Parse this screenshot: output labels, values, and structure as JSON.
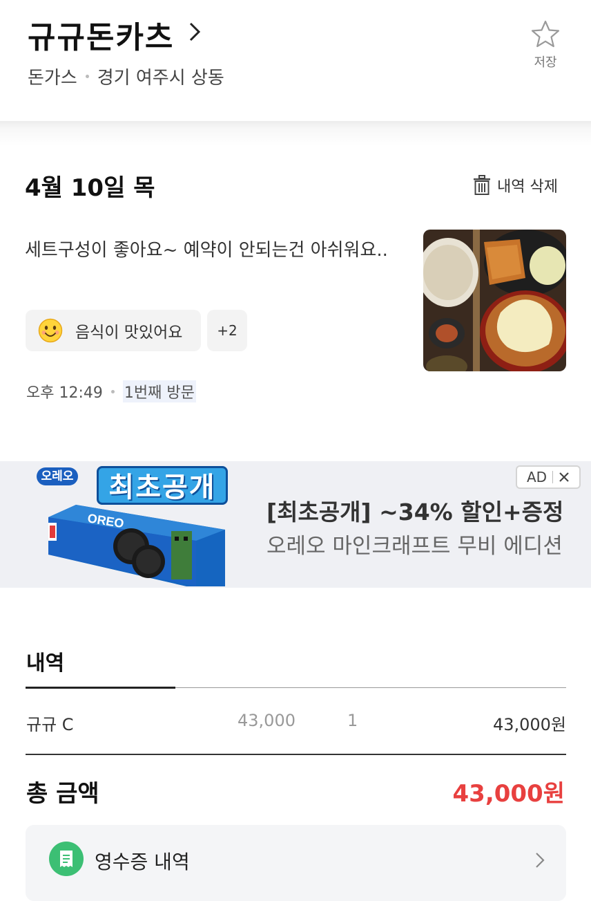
{
  "header": {
    "store_name": "규규돈카츠",
    "category": "돈가스",
    "location": "경기 여주시 상동",
    "save_label": "저장"
  },
  "review": {
    "date": "4월 10일 목",
    "delete_label": "내역 삭제",
    "text": "세트구성이 좋아요~ 예약이 안되는건 아쉬워요..",
    "tag_label": "음식이 맛있어요",
    "more_tags": "+2",
    "time": "오후 12:49",
    "visit_count": "1번째 방문"
  },
  "ad": {
    "badge": "AD",
    "brand_small": "오레오",
    "brand_title": "최초공개",
    "product_box_brand": "OREO",
    "headline": "[최초공개] ~34% 할인+증정",
    "subline": "오레오 마인크래프트 무비 에디션"
  },
  "order": {
    "section_title": "내역",
    "items": [
      {
        "name": "규규 C",
        "price": "43,000",
        "qty": "1",
        "total": "43,000원"
      }
    ],
    "total_label": "총 금액",
    "total_value": "43,000원",
    "receipt_label": "영수증 내역"
  },
  "colors": {
    "accent_red": "#e8403f",
    "receipt_green": "#3cbf74",
    "ad_bg": "#eff0f4"
  }
}
